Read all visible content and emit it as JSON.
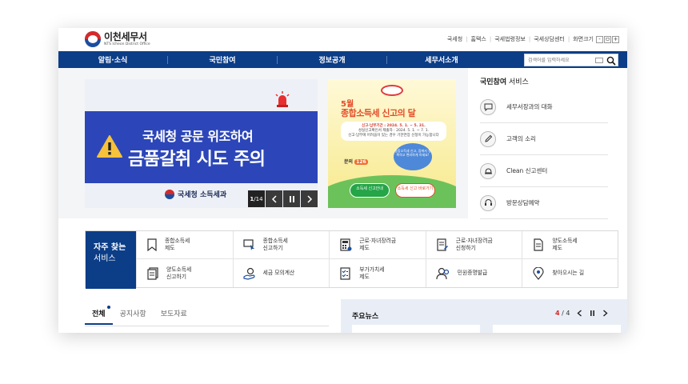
{
  "header": {
    "logo_title": "이천세무서",
    "logo_subtitle": "NTS Icheon District Office",
    "util_links": [
      "국세청",
      "홈택스",
      "국세법령정보",
      "국세상담센터",
      "화면크기"
    ],
    "zoom_minus": "-",
    "zoom_reset": "ㅁ",
    "zoom_plus": "+"
  },
  "nav": {
    "items": [
      "알림·소식",
      "국민참여",
      "정보공개",
      "세무서소개"
    ],
    "search_placeholder": "검색어를 입력하세요"
  },
  "banner1": {
    "line1": "국세청 공문 위조하여",
    "line2": "금품갈취 시도 주의",
    "footer": "국세청 소득세과",
    "page_current": "1",
    "page_total": "14"
  },
  "banner2": {
    "month": "5월",
    "title": "종합소득세 신고의 달",
    "period": "신고·납부기간 : 2024. 5. 1. ~ 5. 31.",
    "note1": "성실신고확인서 제출자 : 2024. 5. 1. ~ 7. 1.",
    "note2": "신고·납부에 어려움이 있는 경우 기한연장 신청이 가능합니다",
    "inquiry_prefix": "문의",
    "inquiry_number": "126",
    "bubble_text": "종합소득세 신고, 집에서 정확하고 편리하게 하세요!",
    "btn1": "소득세 신고안내",
    "btn2": "소득세 신고 바로가기"
  },
  "services": {
    "title_bold": "국민참여",
    "title_rest": "서비스",
    "items": [
      {
        "label": "세무서장과의 대화",
        "icon": "chat-icon"
      },
      {
        "label": "고객의 소리",
        "icon": "pencil-icon"
      },
      {
        "label": "Clean 신고센터",
        "icon": "bell-icon"
      },
      {
        "label": "방문상담예약",
        "icon": "headset-icon"
      }
    ]
  },
  "frequent": {
    "title": "자주 찾는",
    "title2": "서비스",
    "items": [
      {
        "line1": "종합소득세",
        "line2": "제도",
        "icon": "bookmark-icon"
      },
      {
        "line1": "종합소득세",
        "line2": "신고하기",
        "icon": "cursor-icon"
      },
      {
        "line1": "근로·자녀장려금",
        "line2": "제도",
        "icon": "calculator-icon"
      },
      {
        "line1": "근로·자녀장려금",
        "line2": "신청하기",
        "icon": "document-edit-icon"
      },
      {
        "line1": "양도소득세",
        "line2": "제도",
        "icon": "document-icon"
      },
      {
        "line1": "양도소득세",
        "line2": "신고하기",
        "icon": "document-stack-icon"
      },
      {
        "line1": "세금 모의계산",
        "line2": "",
        "icon": "hand-coin-icon"
      },
      {
        "line1": "부가가치세",
        "line2": "제도",
        "icon": "checklist-icon"
      },
      {
        "line1": "민원증명발급",
        "line2": "",
        "icon": "people-icon"
      },
      {
        "line1": "찾아오시는 길",
        "line2": "",
        "icon": "map-pin-icon"
      }
    ]
  },
  "tabs": [
    "전체",
    "공지사항",
    "보도자료"
  ],
  "news": {
    "title": "주요뉴스",
    "page_current": "4",
    "page_sep": "/",
    "page_total": "4"
  },
  "colors": {
    "nav_bg": "#0c3d87",
    "banner1_bg": "#2c46b9",
    "accent_red": "#d52a2a"
  }
}
